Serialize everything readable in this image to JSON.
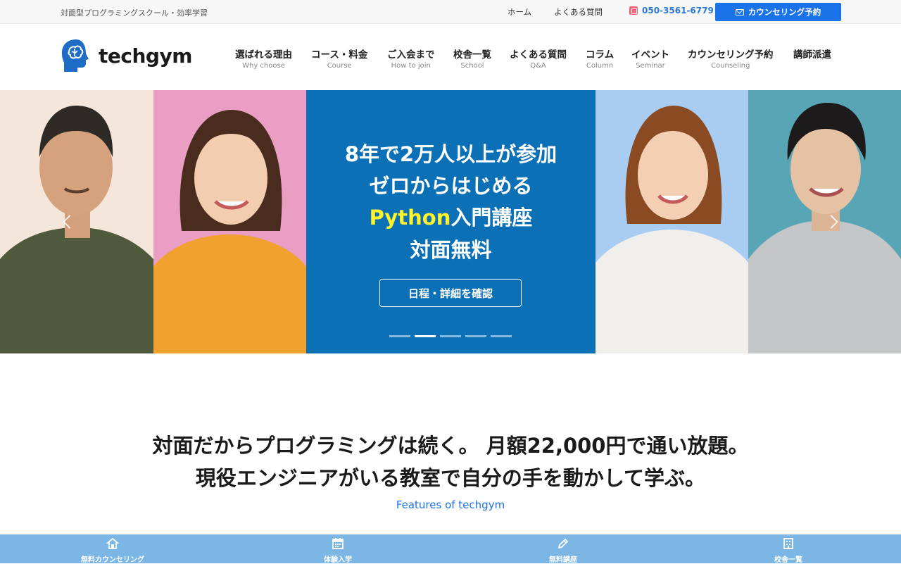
{
  "topbar": {
    "tagline": "対面型プログラミングスクール・効率学習",
    "home": "ホーム",
    "faq": "よくある質問",
    "phone": "050-3561-6779",
    "cta": "カウンセリング予約"
  },
  "header": {
    "brand": "techgym",
    "nav": [
      {
        "jp": "選ばれる理由",
        "en": "Why choose"
      },
      {
        "jp": "コース・料金",
        "en": "Course"
      },
      {
        "jp": "ご入会まで",
        "en": "How to join"
      },
      {
        "jp": "校舎一覧",
        "en": "School"
      },
      {
        "jp": "よくある質問",
        "en": "Q&A"
      },
      {
        "jp": "コラム",
        "en": "Column"
      },
      {
        "jp": "イベント",
        "en": "Seminar"
      },
      {
        "jp": "カウンセリング予約",
        "en": "Counseling"
      },
      {
        "jp": "講師派遣",
        "en": ""
      }
    ]
  },
  "hero": {
    "line1": "8年で2万人以上が参加",
    "line2": "ゼロからはじめる",
    "line3_highlight": "Python",
    "line3_rest": "入門講座",
    "line4": "対面無料",
    "button": "日程・詳細を確認",
    "slides_total": 5,
    "slide_active": 2,
    "colors": {
      "center_bg": "#0b70b5",
      "highlight": "#fff32a"
    }
  },
  "main": {
    "headline_line1": "対面だからプログラミングは続く。 月額22,000円で通い放題。",
    "headline_line2": "現役エンジニアがいる教室で自分の手を動かして学ぶ。",
    "features": "Features of techgym"
  },
  "bottombar": [
    {
      "label": "無料カウンセリング",
      "icon": "home-icon"
    },
    {
      "label": "体験入学",
      "icon": "calendar-icon"
    },
    {
      "label": "無料講座",
      "icon": "pencil-icon"
    },
    {
      "label": "校舎一覧",
      "icon": "building-icon"
    }
  ]
}
